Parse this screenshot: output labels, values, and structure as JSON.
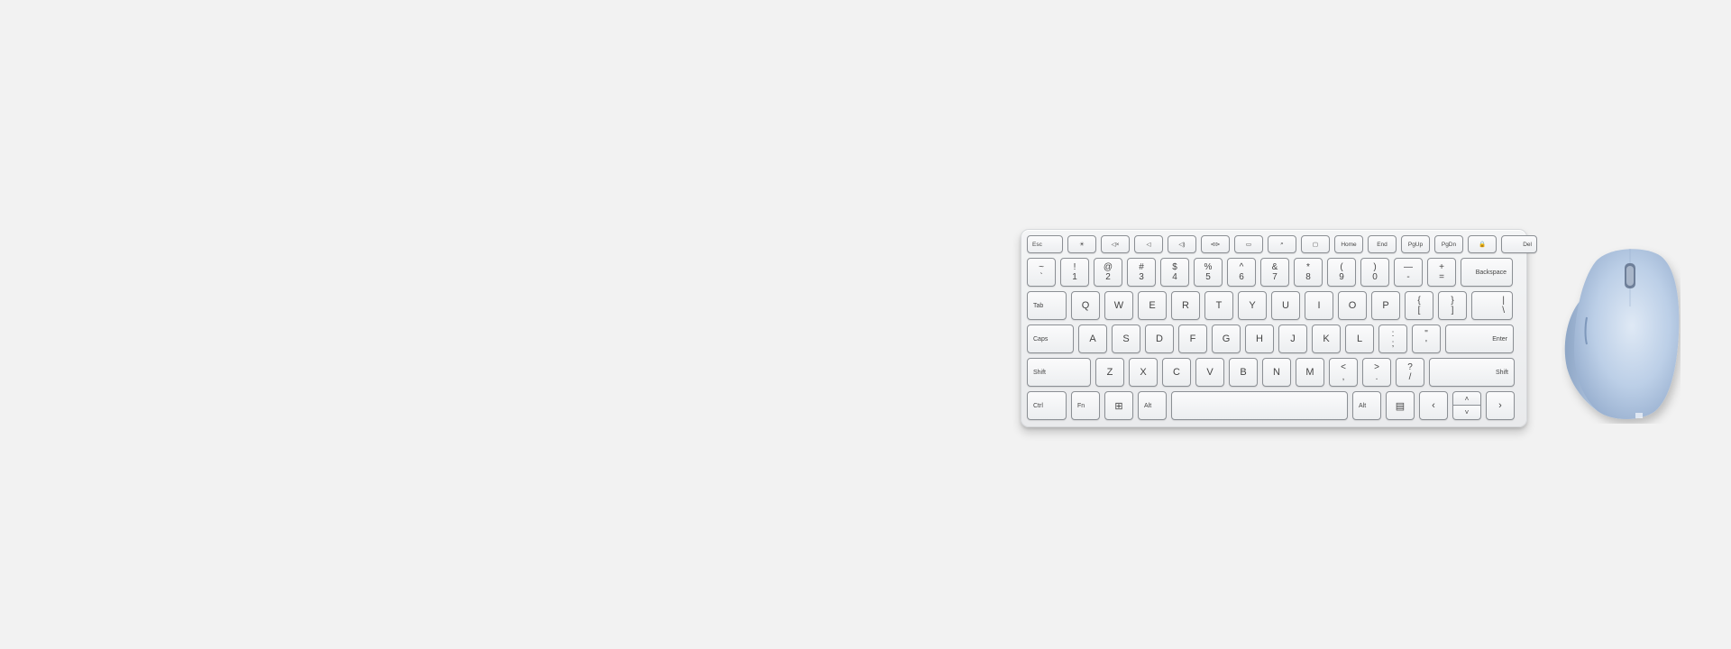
{
  "scene": {
    "background_color": "#f2f2f2",
    "keyboard_color": "#f0f1f3",
    "mouse_color": "#b9cde6"
  },
  "keyboard": {
    "function_row": [
      "Esc",
      "☀",
      "◁×",
      "◁",
      "◁)",
      "⊲⊳",
      "▭",
      "⌕",
      "▢",
      "Home",
      "End",
      "PgUp",
      "PgDn",
      "🔒",
      "Del"
    ],
    "number_row": [
      {
        "top": "~",
        "bottom": "`"
      },
      {
        "top": "!",
        "bottom": "1"
      },
      {
        "top": "@",
        "bottom": "2"
      },
      {
        "top": "#",
        "bottom": "3"
      },
      {
        "top": "$",
        "bottom": "4"
      },
      {
        "top": "%",
        "bottom": "5"
      },
      {
        "top": "^",
        "bottom": "6"
      },
      {
        "top": "&",
        "bottom": "7"
      },
      {
        "top": "*",
        "bottom": "8"
      },
      {
        "top": "(",
        "bottom": "9"
      },
      {
        "top": ")",
        "bottom": "0"
      },
      {
        "top": "—",
        "bottom": "-"
      },
      {
        "top": "+",
        "bottom": "="
      }
    ],
    "backspace_label": "Backspace",
    "tab_label": "Tab",
    "qwerty_row": [
      "Q",
      "W",
      "E",
      "R",
      "T",
      "Y",
      "U",
      "I",
      "O",
      "P"
    ],
    "brace_open": {
      "top": "{",
      "bottom": "["
    },
    "brace_close": {
      "top": "}",
      "bottom": "]"
    },
    "pipe": {
      "top": "|",
      "bottom": "\\"
    },
    "caps_label": "Caps",
    "home_row": [
      "A",
      "S",
      "D",
      "F",
      "G",
      "H",
      "J",
      "K",
      "L"
    ],
    "colon": {
      "top": ":",
      "bottom": ";"
    },
    "quote": {
      "top": "\"",
      "bottom": "'"
    },
    "enter_label": "Enter",
    "shift_label": "Shift",
    "bottom_letter_row": [
      "Z",
      "X",
      "C",
      "V",
      "B",
      "N",
      "M"
    ],
    "lt": {
      "top": "<",
      "bottom": ","
    },
    "gt": {
      "top": ">",
      "bottom": "."
    },
    "question": {
      "top": "?",
      "bottom": "/"
    },
    "right_shift_label": "Shift",
    "ctrl_label": "Ctrl",
    "fn_label": "Fn",
    "win_glyph": "⊞",
    "alt_label": "Alt",
    "alt_right_label": "Alt",
    "menu_glyph": "▤",
    "arrow_left": "‹",
    "arrow_up": "˄",
    "arrow_down": "˅",
    "arrow_right": "›"
  }
}
